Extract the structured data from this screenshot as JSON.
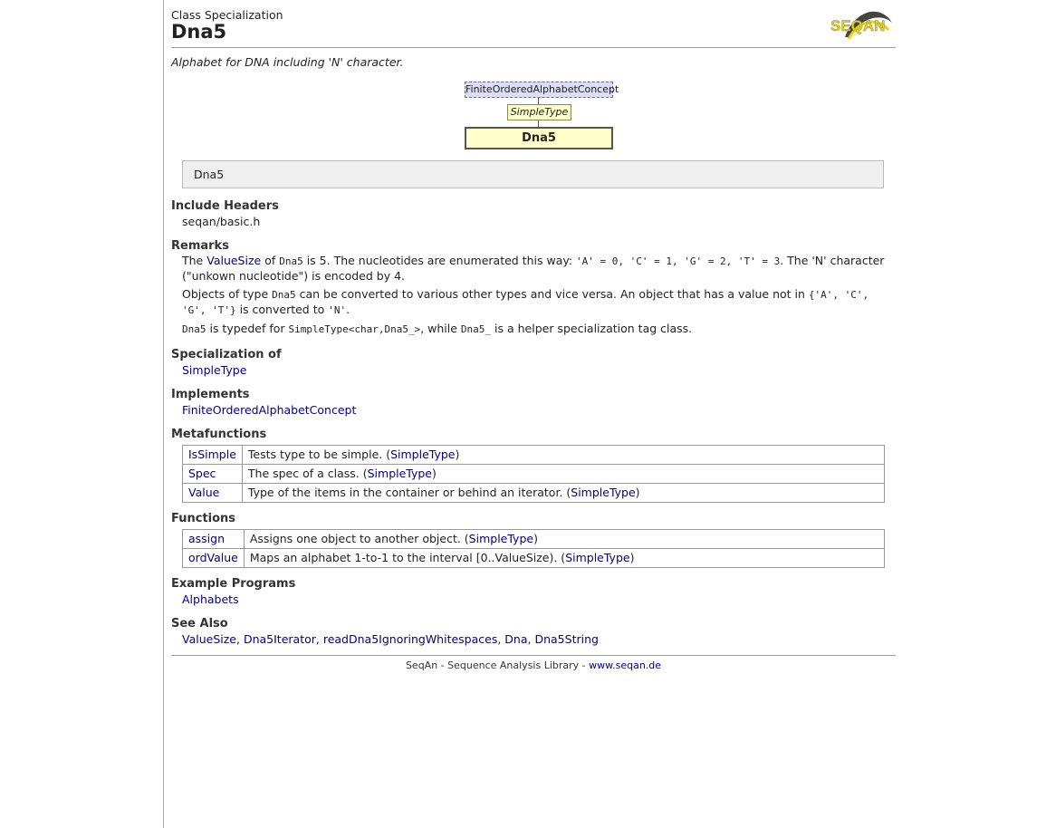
{
  "header": {
    "kind": "Class Specialization",
    "title": "Dna5",
    "logo_text": "SEQAN"
  },
  "summary": "Alphabet for DNA including 'N' character.",
  "diagram": {
    "concept": "FiniteOrderedAlphabetConcept",
    "parent": "SimpleType",
    "self": "Dna5"
  },
  "signature": "Dna5",
  "include": {
    "heading": "Include Headers",
    "value": "seqan/basic.h"
  },
  "remarks": {
    "heading": "Remarks",
    "p1": {
      "t1": "The ",
      "link": "ValueSize",
      "t2": " of ",
      "code1": "Dna5",
      "t3": " is 5. The nucleotides are enumerated this way: ",
      "code2": "'A' = 0, 'C' = 1, 'G' = 2, 'T' = 3",
      "t4": ". The 'N' character (\"unkown nucleotide\") is encoded by 4."
    },
    "p2": {
      "t1": "Objects of type ",
      "code1": "Dna5",
      "t2": " can be converted to various other types and vice versa. An object that has a value not in ",
      "code2": "{'A', 'C', 'G', 'T'}",
      "t3": " is converted to ",
      "code3": "'N'",
      "t4": "."
    },
    "p3": {
      "code1": "Dna5",
      "t1": " is typedef for ",
      "code2": "SimpleType<char,Dna5_>",
      "t2": ", while ",
      "code3": "Dna5_",
      "t3": " is a helper specialization tag class."
    }
  },
  "specialization": {
    "heading": "Specialization of",
    "link": "SimpleType"
  },
  "implements": {
    "heading": "Implements",
    "link": "FiniteOrderedAlphabetConcept"
  },
  "metafunctions": {
    "heading": "Metafunctions",
    "rows": [
      {
        "name": "IsSimple",
        "desc": "Tests type to be simple. (",
        "link": "SimpleType",
        "end": ")"
      },
      {
        "name": "Spec",
        "desc": "The spec of a class. (",
        "link": "SimpleType",
        "end": ")"
      },
      {
        "name": "Value",
        "desc": "Type of the items in the container or behind an iterator. (",
        "link": "SimpleType",
        "end": ")"
      }
    ]
  },
  "functions": {
    "heading": "Functions",
    "rows": [
      {
        "name": "assign",
        "desc": "Assigns one object to another object. (",
        "link": "SimpleType",
        "end": ")"
      },
      {
        "name": "ordValue",
        "desc": "Maps an alphabet 1-to-1 to the interval [0..ValueSize). (",
        "link": "SimpleType",
        "end": ")"
      }
    ]
  },
  "examples": {
    "heading": "Example Programs",
    "link": "Alphabets"
  },
  "see_also": {
    "heading": "See Also",
    "links": [
      "ValueSize",
      "Dna5Iterator",
      "readDna5IgnoringWhitespaces",
      "Dna",
      "Dna5String"
    ],
    "sep": ", "
  },
  "footer": {
    "text": "SeqAn - Sequence Analysis Library - ",
    "link": "www.seqan.de"
  },
  "colors": {
    "link": "#00008b",
    "concept_box": "#ddddf4",
    "class_box": "#ffffcc",
    "logo_yellow": "#e8d400"
  }
}
